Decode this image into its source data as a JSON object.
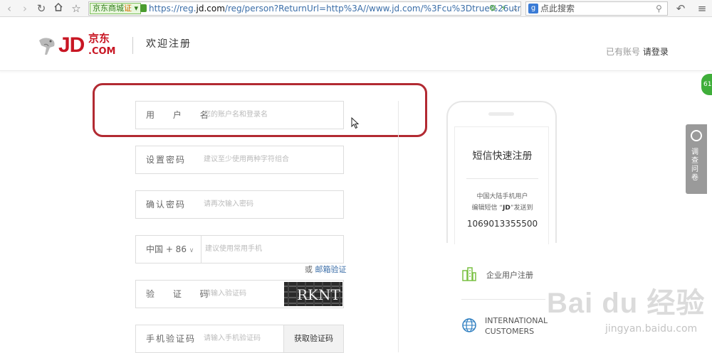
{
  "browser": {
    "site_badge": "京东商城",
    "site_badge_sub": "证",
    "url_prefix": "https://reg.",
    "url_domain": "jd.com",
    "url_rest": "/reg/person?ReturnUrl=http%3A//www.jd.com/%3Fcu%3Dtrue%26utn",
    "search_placeholder": "点此搜索"
  },
  "header": {
    "logo_text": "JD",
    "logo_cn": "京东",
    "logo_com": ".COM",
    "welcome": "欢迎注册",
    "have_account": "已有账号",
    "login_link": "请登录"
  },
  "form": {
    "username": {
      "label": "用 户 名",
      "placeholder": "您的账户名和登录名"
    },
    "password": {
      "label": "设置密码",
      "placeholder": "建议至少使用两种字符组合"
    },
    "confirm": {
      "label": "确认密码",
      "placeholder": "请再次输入密码"
    },
    "phone": {
      "country": "中国 + 86",
      "placeholder": "建议使用常用手机"
    },
    "or_text": "或",
    "email_verify": "邮箱验证",
    "captcha": {
      "label": "验 证 码",
      "placeholder": "请输入验证码",
      "image_text": "RKNT"
    },
    "sms": {
      "label": "手机验证码",
      "placeholder": "请输入手机验证码",
      "button": "获取验证码"
    }
  },
  "sms_register": {
    "title": "短信快速注册",
    "line1": "中国大陆手机用户",
    "line2_prefix": "编辑短信 “",
    "line2_code": "JD",
    "line2_suffix": "”发送到",
    "number": "1069013355500"
  },
  "side_links": {
    "enterprise": "企业用户注册",
    "intl_line1": "INTERNATIONAL",
    "intl_line2": "CUSTOMERS"
  },
  "widgets": {
    "survey": "调查问卷",
    "badge": "61"
  },
  "watermark": {
    "main": "Bai du 经验",
    "sub": "jingyan.baidu.com"
  },
  "colors": {
    "brand_red": "#c81623",
    "annotation": "#b22a32",
    "link_blue": "#3b6ea8",
    "green_icon": "#7ac143",
    "blue_icon": "#2f7fc1"
  }
}
